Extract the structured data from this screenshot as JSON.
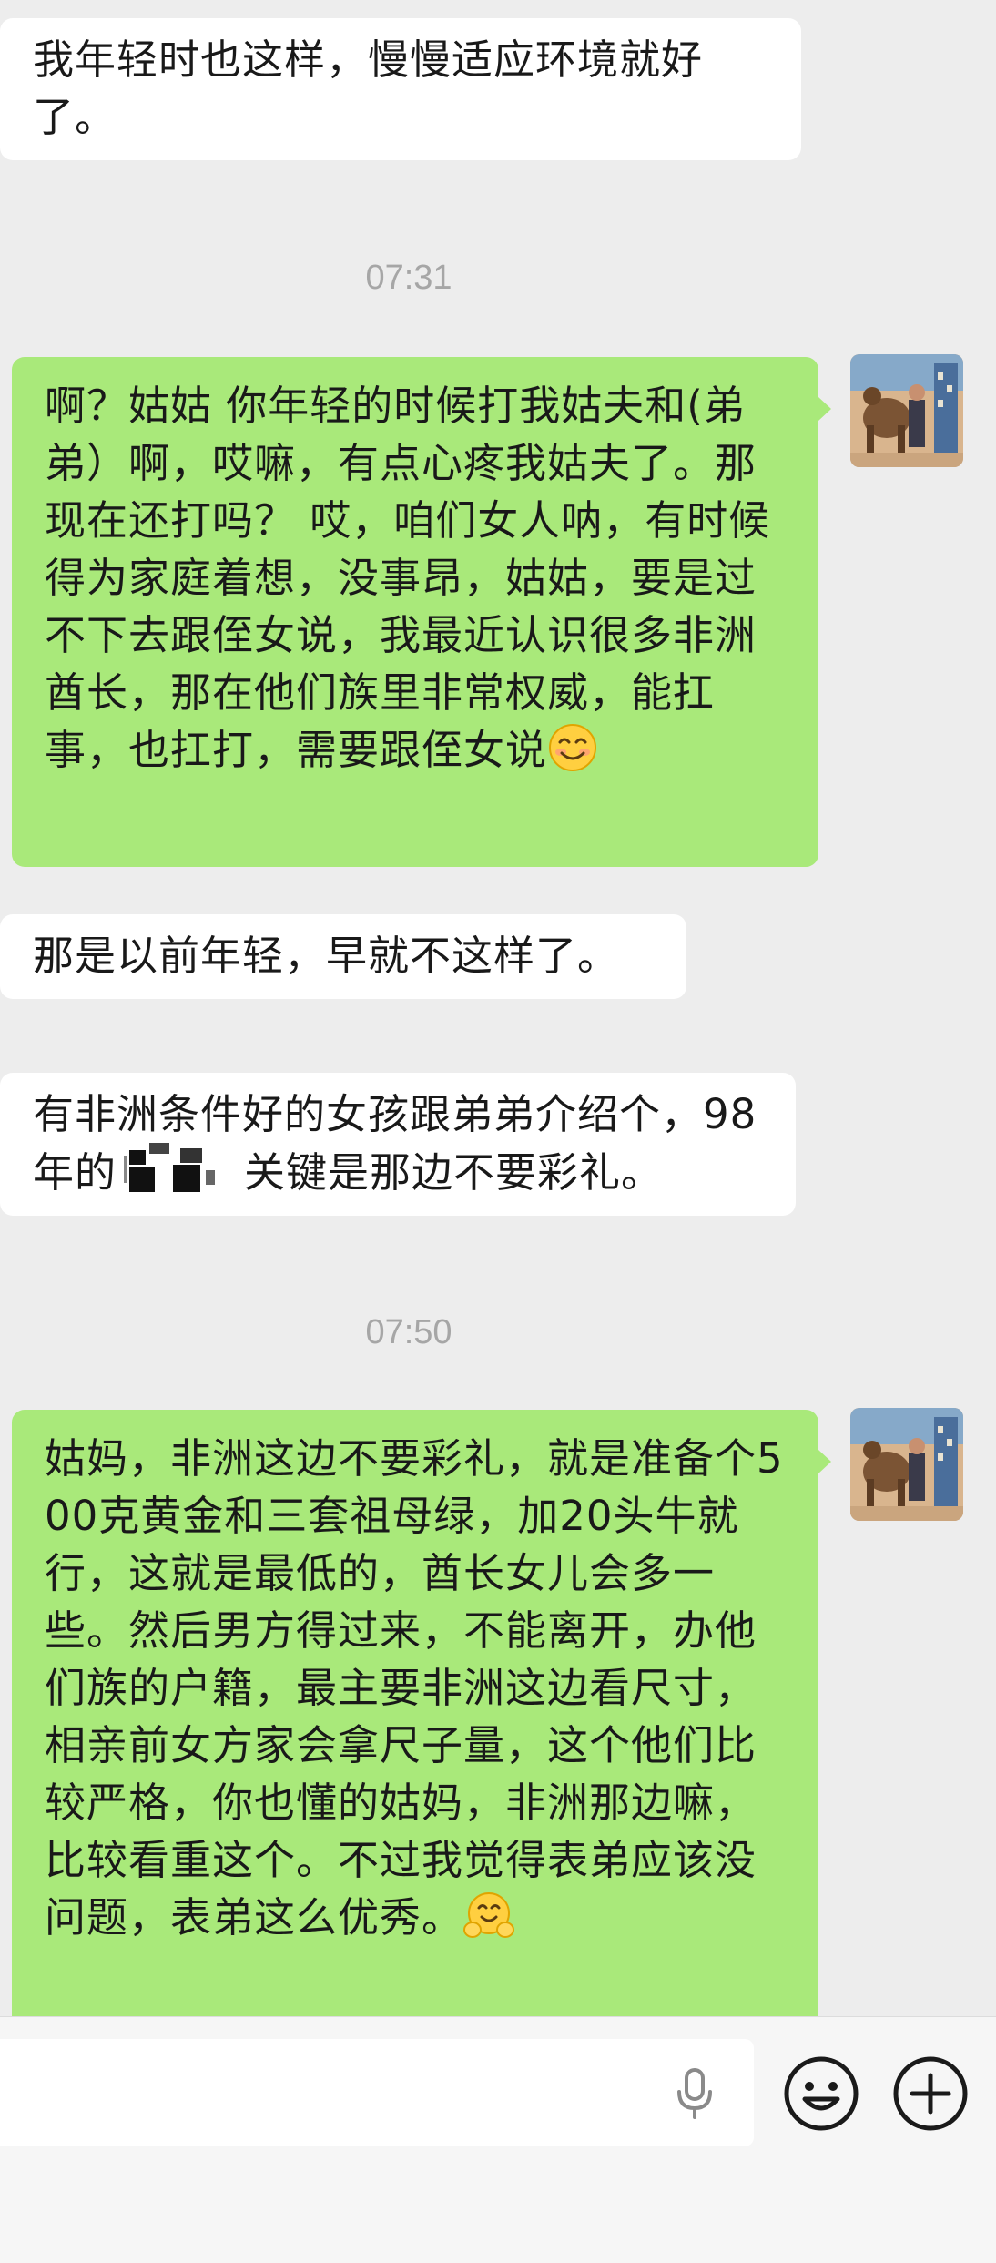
{
  "messages": [
    {
      "side": "in",
      "text": "我年轻时也这样，慢慢适应环境就好了。"
    },
    {
      "type": "time",
      "text": "07:31"
    },
    {
      "side": "out",
      "text": "啊？姑姑 你年轻的时候打我姑夫和(弟弟）啊，哎嘛，有点心疼我姑夫了。那现在还打吗？ 哎，咱们女人呐，有时候得为家庭着想，没事昂，姑姑，要是过不下去跟侄女说，我最近认识很多非洲酋长，那在他们族里非常权威，能扛事，也扛打，需要跟侄女说",
      "emoji": "smiling-face-icon"
    },
    {
      "side": "in",
      "text": "那是以前年轻，早就不这样了。"
    },
    {
      "side": "in",
      "text_part1": "有非洲条件好的女孩跟弟弟介绍个，98年的",
      "text_part2": "关键是那边不要彩礼。"
    },
    {
      "type": "time",
      "text": "07:50"
    },
    {
      "side": "out",
      "text": "姑妈，非洲这边不要彩礼，就是准备个500克黄金和三套祖母绿，加20头牛就行，这就是最低的，酋长女儿会多一些。然后男方得过来，不能离开，办他们族的户籍，最主要非洲这边看尺寸，相亲前女方家会拿尺子量，这个他们比较严格，你也懂的姑妈，非洲那边嘛，比较看重这个。不过我觉得表弟应该没问题，表弟这么优秀。",
      "emoji": "hugging-face-icon"
    }
  ],
  "input": {
    "value": "",
    "icons": [
      "microphone-icon",
      "emoji-icon",
      "plus-icon"
    ]
  },
  "colors": {
    "background": "#ededed",
    "incoming_bubble": "#ffffff",
    "outgoing_bubble": "#a9e97a",
    "timestamp": "#a6a6a6"
  }
}
